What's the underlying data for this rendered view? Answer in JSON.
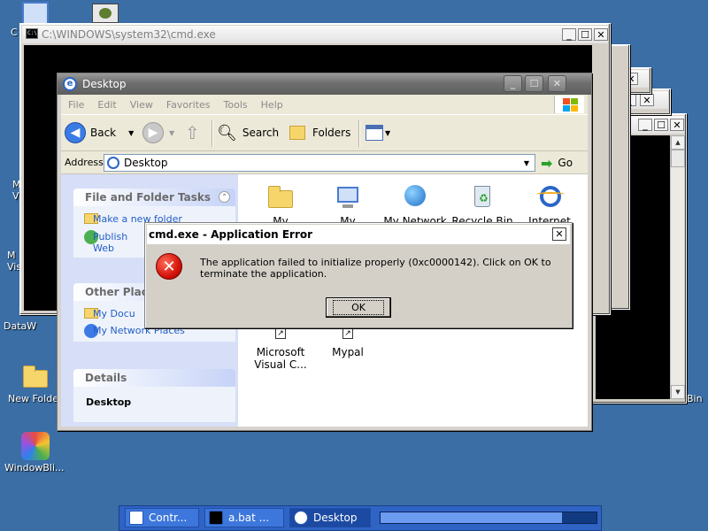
{
  "desktop_icons": [
    {
      "label": "C",
      "name": "desktop-icon-top-left"
    },
    {
      "label": "M\nVi",
      "name": "desktop-icon-m-vi-1"
    },
    {
      "label": "M\nVis",
      "name": "desktop-icon-m-vis-2"
    },
    {
      "label": "DataW",
      "name": "desktop-icon-dataw"
    },
    {
      "label": "New Folde",
      "name": "desktop-icon-new-folder"
    },
    {
      "label": "WindowBli...",
      "name": "desktop-icon-windowblinds"
    },
    {
      "label": "Bin",
      "name": "desktop-icon-recycle-bin-partial"
    }
  ],
  "cmd_windows": {
    "main_title": "C:\\WINDOWS\\system32\\cmd.exe"
  },
  "explorer": {
    "title": "Desktop",
    "menu": [
      "File",
      "Edit",
      "View",
      "Favorites",
      "Tools",
      "Help"
    ],
    "toolbar": {
      "back": "Back",
      "search": "Search",
      "folders": "Folders"
    },
    "address_label": "Address",
    "address_value": "Desktop",
    "go_label": "Go",
    "task_pane": {
      "file_folder_tasks": "File and Folder Tasks",
      "make_folder": "Make a new folder",
      "publish": "Publish",
      "publish_2": "Web",
      "other_places": "Other Places",
      "my_docs": "My Docu",
      "my_network": "My Network Places",
      "details": "Details",
      "details_value": "Desktop"
    },
    "items": [
      {
        "label": "My",
        "icon": "my-documents-icon"
      },
      {
        "label": "My",
        "icon": "my-computer-icon"
      },
      {
        "label": "My Network",
        "icon": "my-network-places-icon"
      },
      {
        "label": "Recycle Bin",
        "icon": "recycle-bin-icon"
      },
      {
        "label": "Internet",
        "icon": "internet-explorer-icon"
      },
      {
        "label": "Microsoft\nVisual C...",
        "icon": "shortcut-icon"
      },
      {
        "label": "Mypal",
        "icon": "shortcut-icon"
      }
    ]
  },
  "dialog": {
    "title": "cmd.exe - Application Error",
    "message": "The application failed to initialize properly (0xc0000142). Click on OK to terminate the application.",
    "ok": "OK",
    "close": "✕"
  },
  "taskbar": {
    "tasks": [
      "Contr...",
      "a.bat ...",
      "Desktop"
    ],
    "progress_fraction": 0.84
  },
  "colors": {
    "desktop": "#3a6ea5",
    "link": "#215dc6",
    "error": "#d3140a"
  }
}
